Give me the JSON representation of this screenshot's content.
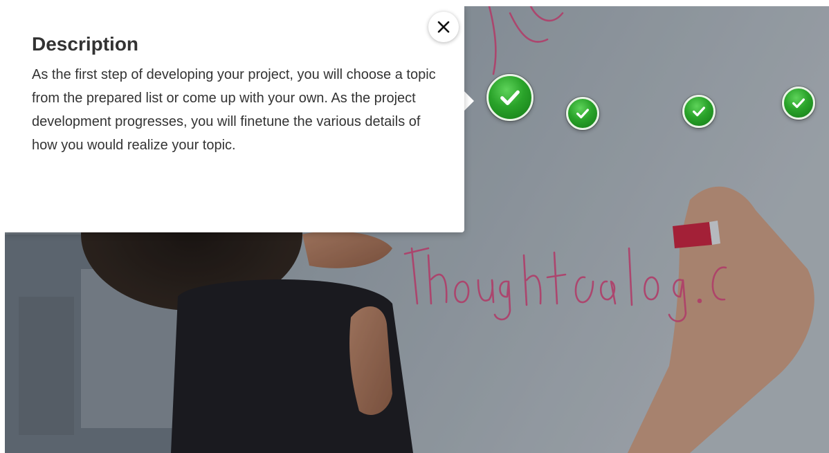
{
  "popup": {
    "title": "Description",
    "body": "As the first step of developing your project, you will choose a topic from the prepared list or come up with your own. As the project development progresses, you will finetune the various details of how you would realize your topic."
  },
  "icons": {
    "close": "close-icon",
    "hotspot": "checkmark-icon"
  },
  "colors": {
    "hotspot_green": "#2aa32a",
    "hotspot_ring": "#e9f3e6",
    "marker_pink": "#d1477a",
    "popup_text": "#333333"
  },
  "background": {
    "whiteboard_writing": "Thoughtcatalog.co"
  }
}
